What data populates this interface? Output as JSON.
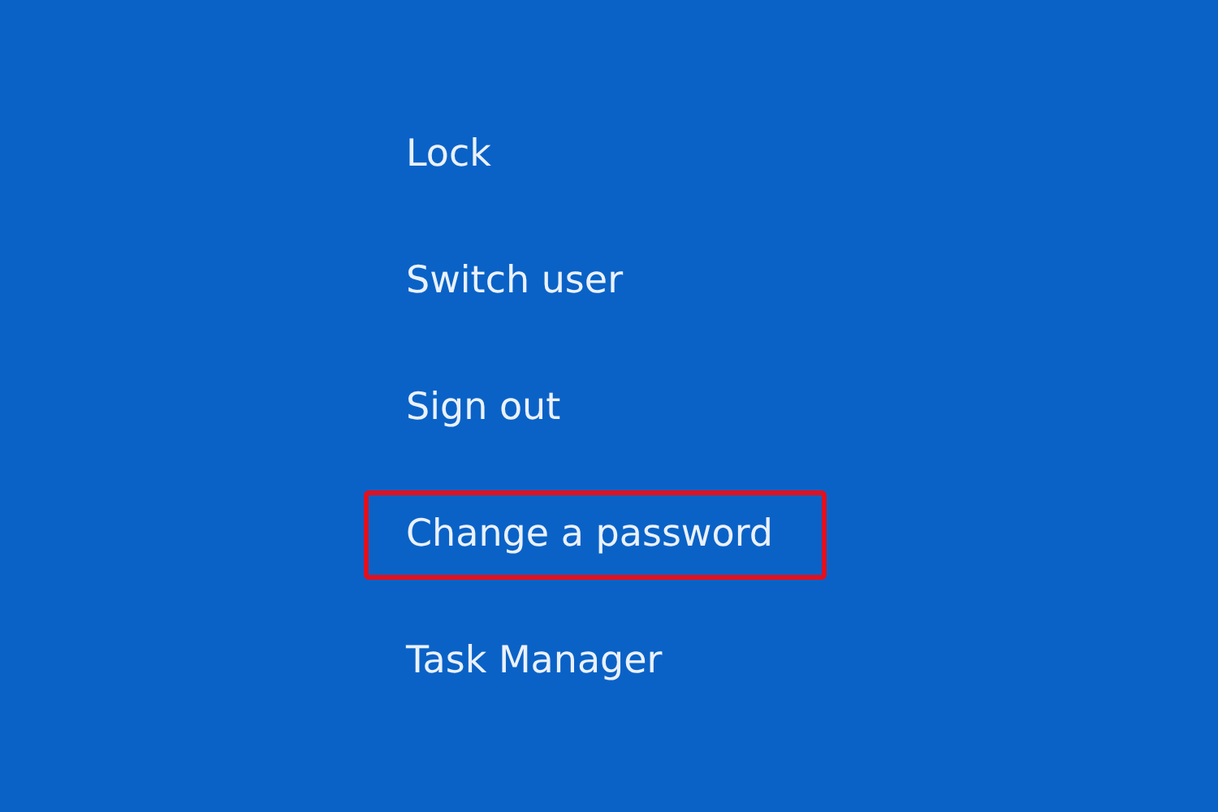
{
  "menu": [
    {
      "label": "Lock",
      "highlighted": false
    },
    {
      "label": "Switch user",
      "highlighted": false
    },
    {
      "label": "Sign out",
      "highlighted": false
    },
    {
      "label": "Change a password",
      "highlighted": true
    },
    {
      "label": "Task Manager",
      "highlighted": false
    }
  ]
}
